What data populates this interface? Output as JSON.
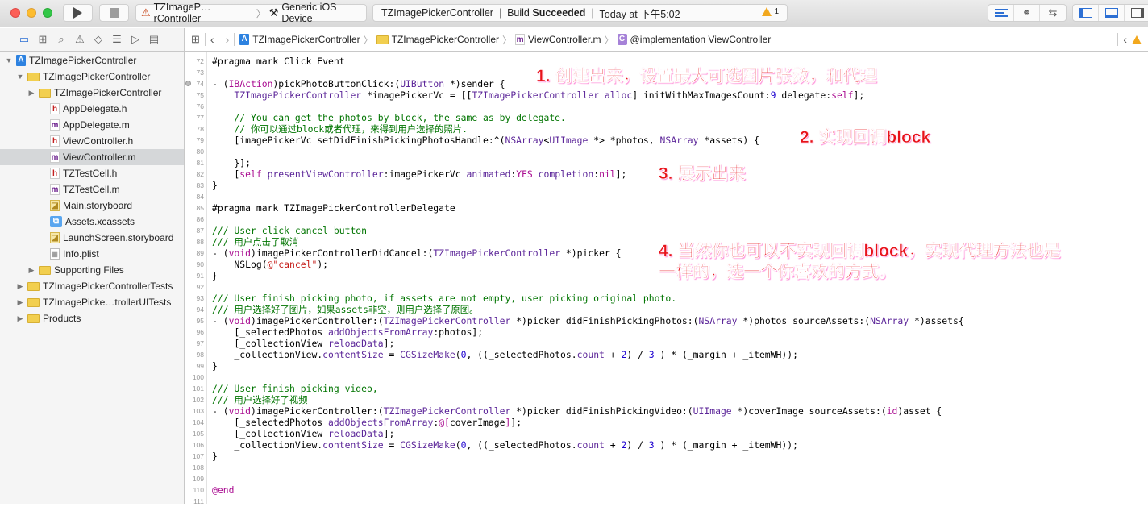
{
  "toolbar": {
    "scheme": "TZImageP…rController",
    "destination": "Generic iOS Device",
    "activity": {
      "project": "TZImagePickerController",
      "build_prefix": "Build ",
      "build_status": "Succeeded",
      "time": "Today at 下午5:02",
      "warning_count": "1"
    },
    "colors": {
      "accent": "#2c6fd4",
      "warning": "#f2a81e"
    }
  },
  "navigator_icons": [
    "folder-icon",
    "hierarchy-icon",
    "search-icon",
    "warning-icon",
    "breakpoint-icon",
    "list-icon",
    "tag-icon",
    "comment-icon"
  ],
  "jumpbar": {
    "crumbs": [
      {
        "label": "TZImagePickerController",
        "icon": "project-icon"
      },
      {
        "label": "TZImagePickerController",
        "icon": "folder-icon"
      },
      {
        "label": "ViewController.m",
        "icon": "m-file-icon"
      },
      {
        "label": "@implementation ViewController",
        "icon": "class-icon"
      }
    ]
  },
  "sidebar": {
    "items": [
      {
        "label": "TZImagePickerController",
        "depth": 0,
        "disclosure": "▼",
        "icon": "proj"
      },
      {
        "label": "TZImagePickerController",
        "depth": 1,
        "disclosure": "▼",
        "icon": "folder"
      },
      {
        "label": "TZImagePickerController",
        "depth": 2,
        "disclosure": "▶",
        "icon": "folder"
      },
      {
        "label": "AppDelegate.h",
        "depth": 3,
        "icon": "h"
      },
      {
        "label": "AppDelegate.m",
        "depth": 3,
        "icon": "m"
      },
      {
        "label": "ViewController.h",
        "depth": 3,
        "icon": "h"
      },
      {
        "label": "ViewController.m",
        "depth": 3,
        "icon": "m",
        "selected": true
      },
      {
        "label": "TZTestCell.h",
        "depth": 3,
        "icon": "h"
      },
      {
        "label": "TZTestCell.m",
        "depth": 3,
        "icon": "m"
      },
      {
        "label": "Main.storyboard",
        "depth": 3,
        "icon": "sb"
      },
      {
        "label": "Assets.xcassets",
        "depth": 3,
        "icon": "assets"
      },
      {
        "label": "LaunchScreen.storyboard",
        "depth": 3,
        "icon": "sb"
      },
      {
        "label": "Info.plist",
        "depth": 3,
        "icon": "plist"
      },
      {
        "label": "Supporting Files",
        "depth": 2,
        "disclosure": "▶",
        "icon": "folder"
      },
      {
        "label": "TZImagePickerControllerTests",
        "depth": 1,
        "disclosure": "▶",
        "icon": "folder"
      },
      {
        "label": "TZImagePicke…trollerUITests",
        "depth": 1,
        "disclosure": "▶",
        "icon": "folder"
      },
      {
        "label": "Products",
        "depth": 1,
        "disclosure": "▶",
        "icon": "folder"
      }
    ]
  },
  "code": {
    "lines": [
      {
        "n": "72",
        "tokens": [
          [
            "p",
            "#pragma mark Click Event"
          ]
        ]
      },
      {
        "n": "73",
        "tokens": []
      },
      {
        "n": "74",
        "bp": true,
        "tokens": [
          [
            "p",
            "- ("
          ],
          [
            "k",
            "IBAction"
          ],
          [
            "p",
            ")pickPhotoButtonClick:("
          ],
          [
            "t",
            "UIButton"
          ],
          [
            "p",
            " *)sender {"
          ]
        ]
      },
      {
        "n": "75",
        "tokens": [
          [
            "p",
            "    "
          ],
          [
            "t",
            "TZImagePickerController"
          ],
          [
            "p",
            " *imagePickerVc = [["
          ],
          [
            "t",
            "TZImagePickerController"
          ],
          [
            "p",
            " "
          ],
          [
            "t",
            "alloc"
          ],
          [
            "p",
            "] initWithMaxImagesCount:"
          ],
          [
            "n",
            "9"
          ],
          [
            "p",
            " delegate:"
          ],
          [
            "k",
            "self"
          ],
          [
            "p",
            "];"
          ]
        ]
      },
      {
        "n": "76",
        "tokens": []
      },
      {
        "n": "77",
        "tokens": [
          [
            "c",
            "    // You can get the photos by block, the same as by delegate."
          ]
        ]
      },
      {
        "n": "78",
        "tokens": [
          [
            "c",
            "    // 你可以通过block或者代理，来得到用户选择的照片."
          ]
        ]
      },
      {
        "n": "79",
        "tokens": [
          [
            "p",
            "    [imagePickerVc setDidFinishPickingPhotosHandle:^("
          ],
          [
            "t",
            "NSArray"
          ],
          [
            "p",
            "<"
          ],
          [
            "t",
            "UIImage"
          ],
          [
            "p",
            " *> *photos, "
          ],
          [
            "t",
            "NSArray"
          ],
          [
            "p",
            " *assets) {"
          ]
        ]
      },
      {
        "n": "80",
        "tokens": []
      },
      {
        "n": "81",
        "tokens": [
          [
            "p",
            "    }];"
          ]
        ]
      },
      {
        "n": "82",
        "tokens": [
          [
            "p",
            "    ["
          ],
          [
            "k",
            "self"
          ],
          [
            "p",
            " "
          ],
          [
            "t",
            "presentViewController"
          ],
          [
            "p",
            ":imagePickerVc "
          ],
          [
            "t",
            "animated"
          ],
          [
            "p",
            ":"
          ],
          [
            "k",
            "YES"
          ],
          [
            "p",
            " "
          ],
          [
            "t",
            "completion"
          ],
          [
            "p",
            ":"
          ],
          [
            "k",
            "nil"
          ],
          [
            "p",
            "];"
          ]
        ]
      },
      {
        "n": "83",
        "tokens": [
          [
            "p",
            "}"
          ]
        ]
      },
      {
        "n": "84",
        "tokens": []
      },
      {
        "n": "85",
        "tokens": [
          [
            "p",
            "#pragma mark TZImagePickerControllerDelegate"
          ]
        ]
      },
      {
        "n": "86",
        "tokens": []
      },
      {
        "n": "87",
        "tokens": [
          [
            "c",
            "/// User click cancel button"
          ]
        ]
      },
      {
        "n": "88",
        "tokens": [
          [
            "c",
            "/// 用户点击了取消"
          ]
        ]
      },
      {
        "n": "89",
        "tokens": [
          [
            "p",
            "- ("
          ],
          [
            "k",
            "void"
          ],
          [
            "p",
            ")imagePickerControllerDidCancel:("
          ],
          [
            "t",
            "TZImagePickerController"
          ],
          [
            "p",
            " *)picker {"
          ]
        ]
      },
      {
        "n": "90",
        "tokens": [
          [
            "p",
            "    NSLog("
          ],
          [
            "s",
            "@\"cancel\""
          ],
          [
            "p",
            ");"
          ]
        ]
      },
      {
        "n": "91",
        "tokens": [
          [
            "p",
            "}"
          ]
        ]
      },
      {
        "n": "92",
        "tokens": []
      },
      {
        "n": "93",
        "tokens": [
          [
            "c",
            "/// User finish picking photo, if assets are not empty, user picking original photo."
          ]
        ]
      },
      {
        "n": "94",
        "tokens": [
          [
            "c",
            "/// 用户选择好了图片，如果assets非空，则用户选择了原图。"
          ]
        ]
      },
      {
        "n": "95",
        "tokens": [
          [
            "p",
            "- ("
          ],
          [
            "k",
            "void"
          ],
          [
            "p",
            ")imagePickerController:("
          ],
          [
            "t",
            "TZImagePickerController"
          ],
          [
            "p",
            " *)picker didFinishPickingPhotos:("
          ],
          [
            "t",
            "NSArray"
          ],
          [
            "p",
            " *)photos sourceAssets:("
          ],
          [
            "t",
            "NSArray"
          ],
          [
            "p",
            " *)assets{"
          ]
        ]
      },
      {
        "n": "96",
        "tokens": [
          [
            "p",
            "    [_selectedPhotos "
          ],
          [
            "t",
            "addObjectsFromArray"
          ],
          [
            "p",
            ":photos];"
          ]
        ]
      },
      {
        "n": "97",
        "tokens": [
          [
            "p",
            "    [_collectionView "
          ],
          [
            "t",
            "reloadData"
          ],
          [
            "p",
            "];"
          ]
        ]
      },
      {
        "n": "98",
        "tokens": [
          [
            "p",
            "    _collectionView."
          ],
          [
            "t",
            "contentSize"
          ],
          [
            "p",
            " = "
          ],
          [
            "t",
            "CGSizeMake"
          ],
          [
            "p",
            "("
          ],
          [
            "n",
            "0"
          ],
          [
            "p",
            ", ((_selectedPhotos."
          ],
          [
            "t",
            "count"
          ],
          [
            "p",
            " + "
          ],
          [
            "n",
            "2"
          ],
          [
            "p",
            ") / "
          ],
          [
            "n",
            "3"
          ],
          [
            "p",
            " ) * (_margin + _itemWH));"
          ]
        ]
      },
      {
        "n": "99",
        "tokens": [
          [
            "p",
            "}"
          ]
        ]
      },
      {
        "n": "100",
        "tokens": []
      },
      {
        "n": "101",
        "tokens": [
          [
            "c",
            "/// User finish picking video,"
          ]
        ]
      },
      {
        "n": "102",
        "tokens": [
          [
            "c",
            "/// 用户选择好了视频"
          ]
        ]
      },
      {
        "n": "103",
        "tokens": [
          [
            "p",
            "- ("
          ],
          [
            "k",
            "void"
          ],
          [
            "p",
            ")imagePickerController:("
          ],
          [
            "t",
            "TZImagePickerController"
          ],
          [
            "p",
            " *)picker didFinishPickingVideo:("
          ],
          [
            "t",
            "UIImage"
          ],
          [
            "p",
            " *)coverImage sourceAssets:("
          ],
          [
            "k",
            "id"
          ],
          [
            "p",
            ")asset {"
          ]
        ]
      },
      {
        "n": "104",
        "tokens": [
          [
            "p",
            "    [_selectedPhotos "
          ],
          [
            "t",
            "addObjectsFromArray"
          ],
          [
            "p",
            ":"
          ],
          [
            "k",
            "@["
          ],
          [
            "p",
            "coverImage"
          ],
          [
            "k",
            "]"
          ],
          [
            "p",
            "];"
          ]
        ]
      },
      {
        "n": "105",
        "tokens": [
          [
            "p",
            "    [_collectionView "
          ],
          [
            "t",
            "reloadData"
          ],
          [
            "p",
            "];"
          ]
        ]
      },
      {
        "n": "106",
        "tokens": [
          [
            "p",
            "    _collectionView."
          ],
          [
            "t",
            "contentSize"
          ],
          [
            "p",
            " = "
          ],
          [
            "t",
            "CGSizeMake"
          ],
          [
            "p",
            "("
          ],
          [
            "n",
            "0"
          ],
          [
            "p",
            ", ((_selectedPhotos."
          ],
          [
            "t",
            "count"
          ],
          [
            "p",
            " + "
          ],
          [
            "n",
            "2"
          ],
          [
            "p",
            ") / "
          ],
          [
            "n",
            "3"
          ],
          [
            "p",
            " ) * (_margin + _itemWH));"
          ]
        ]
      },
      {
        "n": "107",
        "tokens": [
          [
            "p",
            "}"
          ]
        ]
      },
      {
        "n": "108",
        "tokens": []
      },
      {
        "n": "109",
        "tokens": []
      },
      {
        "n": "110",
        "tokens": [
          [
            "k",
            "@end"
          ]
        ]
      },
      {
        "n": "111",
        "tokens": []
      }
    ]
  },
  "annotations": [
    "1. 创建出来，设置最大可选图片张数，和代理",
    "2. 实现回调block",
    "3. 展示出来",
    "4. 当然你也可以不实现回调block，实现代理方法也是\n一样的，选一个你喜欢的方式。"
  ]
}
